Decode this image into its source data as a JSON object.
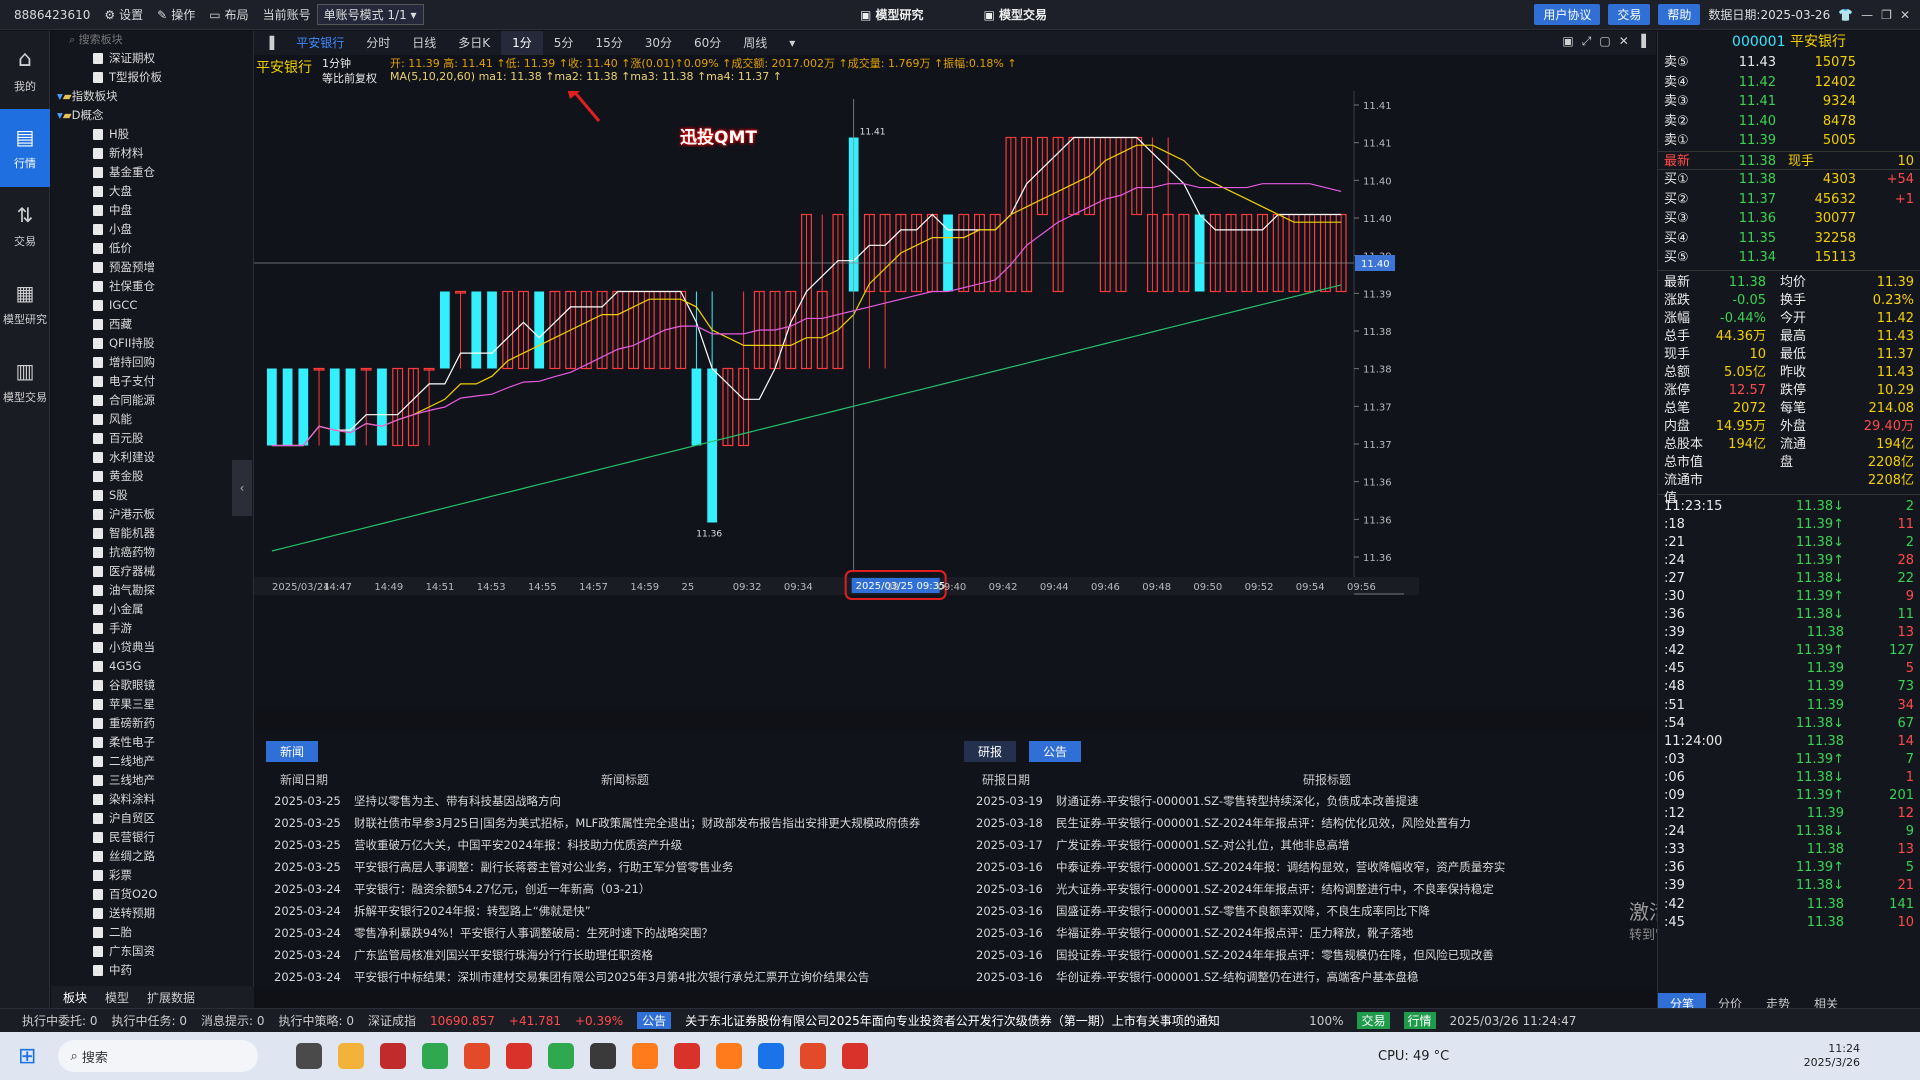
{
  "topbar": {
    "account_id": "8886423610",
    "menu": [
      "设置",
      "操作",
      "布局"
    ],
    "account_label": "当前账号",
    "mode_select": "单账号模式 1/1",
    "center_tabs": [
      "模型研究",
      "模型交易"
    ],
    "right_buttons": [
      "用户协议",
      "交易",
      "帮助"
    ],
    "data_date": "数据日期:2025-03-26"
  },
  "rail": [
    "我的",
    "行情",
    "交易",
    "模型研究",
    "模型交易"
  ],
  "tree": {
    "search_placeholder": "搜索板块",
    "nodes": [
      {
        "label": "深证期权",
        "level": 2,
        "type": "file"
      },
      {
        "label": "T型报价板",
        "level": 2,
        "type": "file"
      },
      {
        "label": "指数板块",
        "level": 1,
        "type": "folder"
      },
      {
        "label": "D概念",
        "level": 1,
        "type": "folder"
      },
      {
        "label": "H股",
        "level": 2,
        "type": "file"
      },
      {
        "label": "新材料",
        "level": 2,
        "type": "file"
      },
      {
        "label": "基金重仓",
        "level": 2,
        "type": "file"
      },
      {
        "label": "大盘",
        "level": 2,
        "type": "file"
      },
      {
        "label": "中盘",
        "level": 2,
        "type": "file"
      },
      {
        "label": "小盘",
        "level": 2,
        "type": "file"
      },
      {
        "label": "低价",
        "level": 2,
        "type": "file"
      },
      {
        "label": "预盈预增",
        "level": 2,
        "type": "file"
      },
      {
        "label": "社保重仓",
        "level": 2,
        "type": "file"
      },
      {
        "label": "IGCC",
        "level": 2,
        "type": "file"
      },
      {
        "label": "西藏",
        "level": 2,
        "type": "file"
      },
      {
        "label": "QFII持股",
        "level": 2,
        "type": "file"
      },
      {
        "label": "增持回购",
        "level": 2,
        "type": "file"
      },
      {
        "label": "电子支付",
        "level": 2,
        "type": "file"
      },
      {
        "label": "合同能源",
        "level": 2,
        "type": "file"
      },
      {
        "label": "风能",
        "level": 2,
        "type": "file"
      },
      {
        "label": "百元股",
        "level": 2,
        "type": "file"
      },
      {
        "label": "水利建设",
        "level": 2,
        "type": "file"
      },
      {
        "label": "黄金股",
        "level": 2,
        "type": "file"
      },
      {
        "label": "S股",
        "level": 2,
        "type": "file"
      },
      {
        "label": "沪港示板",
        "level": 2,
        "type": "file"
      },
      {
        "label": "智能机器",
        "level": 2,
        "type": "file"
      },
      {
        "label": "抗癌药物",
        "level": 2,
        "type": "file"
      },
      {
        "label": "医疗器械",
        "level": 2,
        "type": "file"
      },
      {
        "label": "油气勘探",
        "level": 2,
        "type": "file"
      },
      {
        "label": "小金属",
        "level": 2,
        "type": "file"
      },
      {
        "label": "手游",
        "level": 2,
        "type": "file"
      },
      {
        "label": "小贷典当",
        "level": 2,
        "type": "file"
      },
      {
        "label": "4G5G",
        "level": 2,
        "type": "file"
      },
      {
        "label": "谷歌眼镜",
        "level": 2,
        "type": "file"
      },
      {
        "label": "苹果三星",
        "level": 2,
        "type": "file"
      },
      {
        "label": "重磅新药",
        "level": 2,
        "type": "file"
      },
      {
        "label": "柔性电子",
        "level": 2,
        "type": "file"
      },
      {
        "label": "二线地产",
        "level": 2,
        "type": "file"
      },
      {
        "label": "三线地产",
        "level": 2,
        "type": "file"
      },
      {
        "label": "染料涂料",
        "level": 2,
        "type": "file"
      },
      {
        "label": "沪自贸区",
        "level": 2,
        "type": "file"
      },
      {
        "label": "民营银行",
        "level": 2,
        "type": "file"
      },
      {
        "label": "丝绸之路",
        "level": 2,
        "type": "file"
      },
      {
        "label": "彩票",
        "level": 2,
        "type": "file"
      },
      {
        "label": "百货O2O",
        "level": 2,
        "type": "file"
      },
      {
        "label": "送转预期",
        "level": 2,
        "type": "file"
      },
      {
        "label": "二胎",
        "level": 2,
        "type": "file"
      },
      {
        "label": "广东国资",
        "level": 2,
        "type": "file"
      },
      {
        "label": "中药",
        "level": 2,
        "type": "file"
      }
    ],
    "tabs": [
      "板块",
      "模型",
      "扩展数据"
    ]
  },
  "period_tabs": [
    "平安银行",
    "分时",
    "日线",
    "多日K",
    "1分",
    "5分",
    "15分",
    "30分",
    "60分",
    "周线"
  ],
  "active_period": "1分",
  "info": {
    "stock_name": "平安银行",
    "period": "1分钟",
    "adj": "等比前复权",
    "ohlc": "开: 11.39  高: 11.41 ↑低: 11.39 ↑收: 11.40 ↑涨(0.01)↑0.09% ↑成交额: 2017.002万 ↑成交量: 1.769万 ↑振幅:0.18% ↑",
    "ma_line": "MA(5,10,20,60)  ma1: 11.38 ↑ma2: 11.38 ↑ma3: 11.38 ↑ma4: 11.37 ↑",
    "annotation": "迅投QMT"
  },
  "chart_data": {
    "type": "candlestick",
    "y_ticks": [
      "11.41",
      "11.41",
      "11.40",
      "11.40",
      "11.39",
      "11.39",
      "11.38",
      "11.38",
      "11.37",
      "11.37",
      "11.36",
      "11.36",
      "11.36"
    ],
    "ylim": [
      11.355,
      11.415
    ],
    "x_ticks": [
      "2025/03/24",
      "14:47",
      "14:49",
      "14:51",
      "14:53",
      "14:55",
      "14:57",
      "14:59",
      "25",
      "09:32",
      "09:34",
      "2025/03/25 09:35",
      "38",
      "09:40",
      "09:42",
      "09:44",
      "09:46",
      "09:48",
      "09:50",
      "09:52",
      "09:54",
      "09:56"
    ],
    "crosshair_price": "11.40",
    "crosshair_label": "2025/03/25 09:35",
    "high_label": "11.41",
    "low_label": "11.36",
    "candles": [
      {
        "o": 11.38,
        "h": 11.38,
        "l": 11.37,
        "c": 11.37
      },
      {
        "o": 11.38,
        "h": 11.38,
        "l": 11.37,
        "c": 11.37
      },
      {
        "o": 11.38,
        "h": 11.38,
        "l": 11.37,
        "c": 11.37
      },
      {
        "o": 11.38,
        "h": 11.38,
        "l": 11.37,
        "c": 11.38
      },
      {
        "o": 11.38,
        "h": 11.38,
        "l": 11.37,
        "c": 11.37
      },
      {
        "o": 11.38,
        "h": 11.38,
        "l": 11.37,
        "c": 11.37
      },
      {
        "o": 11.38,
        "h": 11.38,
        "l": 11.37,
        "c": 11.38
      },
      {
        "o": 11.38,
        "h": 11.38,
        "l": 11.37,
        "c": 11.37
      },
      {
        "o": 11.37,
        "h": 11.38,
        "l": 11.37,
        "c": 11.38
      },
      {
        "o": 11.37,
        "h": 11.38,
        "l": 11.37,
        "c": 11.38
      },
      {
        "o": 11.38,
        "h": 11.38,
        "l": 11.37,
        "c": 11.38
      },
      {
        "o": 11.39,
        "h": 11.39,
        "l": 11.38,
        "c": 11.38
      },
      {
        "o": 11.39,
        "h": 11.39,
        "l": 11.38,
        "c": 11.39
      },
      {
        "o": 11.39,
        "h": 11.39,
        "l": 11.38,
        "c": 11.38
      },
      {
        "o": 11.39,
        "h": 11.39,
        "l": 11.38,
        "c": 11.38
      },
      {
        "o": 11.38,
        "h": 11.39,
        "l": 11.38,
        "c": 11.39
      },
      {
        "o": 11.38,
        "h": 11.39,
        "l": 11.38,
        "c": 11.39
      },
      {
        "o": 11.39,
        "h": 11.39,
        "l": 11.38,
        "c": 11.38
      },
      {
        "o": 11.38,
        "h": 11.39,
        "l": 11.38,
        "c": 11.39
      },
      {
        "o": 11.38,
        "h": 11.39,
        "l": 11.38,
        "c": 11.39
      },
      {
        "o": 11.38,
        "h": 11.39,
        "l": 11.38,
        "c": 11.39
      },
      {
        "o": 11.38,
        "h": 11.39,
        "l": 11.38,
        "c": 11.39
      },
      {
        "o": 11.38,
        "h": 11.39,
        "l": 11.38,
        "c": 11.39
      },
      {
        "o": 11.38,
        "h": 11.39,
        "l": 11.38,
        "c": 11.39
      },
      {
        "o": 11.38,
        "h": 11.39,
        "l": 11.38,
        "c": 11.39
      },
      {
        "o": 11.38,
        "h": 11.39,
        "l": 11.38,
        "c": 11.39
      },
      {
        "o": 11.38,
        "h": 11.39,
        "l": 11.38,
        "c": 11.39
      },
      {
        "o": 11.38,
        "h": 11.39,
        "l": 11.37,
        "c": 11.37
      },
      {
        "o": 11.38,
        "h": 11.39,
        "l": 11.36,
        "c": 11.36
      },
      {
        "o": 11.37,
        "h": 11.38,
        "l": 11.37,
        "c": 11.38
      },
      {
        "o": 11.37,
        "h": 11.39,
        "l": 11.37,
        "c": 11.38
      },
      {
        "o": 11.38,
        "h": 11.39,
        "l": 11.38,
        "c": 11.39
      },
      {
        "o": 11.38,
        "h": 11.39,
        "l": 11.38,
        "c": 11.39
      },
      {
        "o": 11.38,
        "h": 11.39,
        "l": 11.38,
        "c": 11.39
      },
      {
        "o": 11.38,
        "h": 11.4,
        "l": 11.38,
        "c": 11.4
      },
      {
        "o": 11.38,
        "h": 11.4,
        "l": 11.38,
        "c": 11.39
      },
      {
        "o": 11.38,
        "h": 11.4,
        "l": 11.38,
        "c": 11.4
      },
      {
        "o": 11.41,
        "h": 11.41,
        "l": 11.39,
        "c": 11.39
      },
      {
        "o": 11.39,
        "h": 11.4,
        "l": 11.38,
        "c": 11.4
      },
      {
        "o": 11.39,
        "h": 11.4,
        "l": 11.38,
        "c": 11.4
      },
      {
        "o": 11.39,
        "h": 11.4,
        "l": 11.39,
        "c": 11.4
      },
      {
        "o": 11.39,
        "h": 11.4,
        "l": 11.39,
        "c": 11.4
      },
      {
        "o": 11.39,
        "h": 11.4,
        "l": 11.39,
        "c": 11.4
      },
      {
        "o": 11.4,
        "h": 11.4,
        "l": 11.39,
        "c": 11.39
      },
      {
        "o": 11.39,
        "h": 11.4,
        "l": 11.39,
        "c": 11.4
      },
      {
        "o": 11.39,
        "h": 11.4,
        "l": 11.39,
        "c": 11.4
      },
      {
        "o": 11.39,
        "h": 11.4,
        "l": 11.39,
        "c": 11.4
      },
      {
        "o": 11.39,
        "h": 11.41,
        "l": 11.39,
        "c": 11.41
      },
      {
        "o": 11.39,
        "h": 11.41,
        "l": 11.39,
        "c": 11.41
      },
      {
        "o": 11.4,
        "h": 11.41,
        "l": 11.4,
        "c": 11.41
      },
      {
        "o": 11.39,
        "h": 11.41,
        "l": 11.39,
        "c": 11.41
      },
      {
        "o": 11.4,
        "h": 11.41,
        "l": 11.4,
        "c": 11.41
      },
      {
        "o": 11.4,
        "h": 11.41,
        "l": 11.4,
        "c": 11.41
      },
      {
        "o": 11.39,
        "h": 11.41,
        "l": 11.39,
        "c": 11.41
      },
      {
        "o": 11.39,
        "h": 11.41,
        "l": 11.39,
        "c": 11.41
      },
      {
        "o": 11.4,
        "h": 11.41,
        "l": 11.4,
        "c": 11.41
      },
      {
        "o": 11.39,
        "h": 11.41,
        "l": 11.39,
        "c": 11.4
      },
      {
        "o": 11.39,
        "h": 11.41,
        "l": 11.39,
        "c": 11.4
      },
      {
        "o": 11.39,
        "h": 11.4,
        "l": 11.39,
        "c": 11.4
      },
      {
        "o": 11.4,
        "h": 11.4,
        "l": 11.39,
        "c": 11.39
      },
      {
        "o": 11.39,
        "h": 11.4,
        "l": 11.39,
        "c": 11.4
      },
      {
        "o": 11.39,
        "h": 11.4,
        "l": 11.39,
        "c": 11.4
      },
      {
        "o": 11.39,
        "h": 11.4,
        "l": 11.39,
        "c": 11.4
      },
      {
        "o": 11.39,
        "h": 11.4,
        "l": 11.39,
        "c": 11.4
      },
      {
        "o": 11.39,
        "h": 11.4,
        "l": 11.39,
        "c": 11.4
      },
      {
        "o": 11.39,
        "h": 11.4,
        "l": 11.39,
        "c": 11.4
      },
      {
        "o": 11.39,
        "h": 11.4,
        "l": 11.39,
        "c": 11.4
      },
      {
        "o": 11.39,
        "h": 11.4,
        "l": 11.39,
        "c": 11.4
      },
      {
        "o": 11.39,
        "h": 11.4,
        "l": 11.39,
        "c": 11.4
      }
    ]
  },
  "right": {
    "code": "000001",
    "name": "平安银行",
    "asks": [
      {
        "label": "卖⑤",
        "price": "11.43",
        "vol": "15075"
      },
      {
        "label": "卖④",
        "price": "11.42",
        "vol": "12402"
      },
      {
        "label": "卖③",
        "price": "11.41",
        "vol": "9324"
      },
      {
        "label": "卖②",
        "price": "11.40",
        "vol": "8478"
      },
      {
        "label": "卖①",
        "price": "11.39",
        "vol": "5005"
      }
    ],
    "last": {
      "label": "最新",
      "price": "11.38",
      "hand": "现手",
      "vol": "10"
    },
    "bids": [
      {
        "label": "买①",
        "price": "11.38",
        "vol": "4303",
        "chg": "+54"
      },
      {
        "label": "买②",
        "price": "11.37",
        "vol": "45632",
        "chg": "+1"
      },
      {
        "label": "买③",
        "price": "11.36",
        "vol": "30077",
        "chg": ""
      },
      {
        "label": "买④",
        "price": "11.35",
        "vol": "32258",
        "chg": ""
      },
      {
        "label": "买⑤",
        "price": "11.34",
        "vol": "15113",
        "chg": ""
      }
    ],
    "stats": [
      [
        "最新",
        "11.38",
        "均价",
        "11.39"
      ],
      [
        "涨跌",
        "-0.05",
        "换手",
        "0.23%"
      ],
      [
        "涨幅",
        "-0.44%",
        "今开",
        "11.42"
      ],
      [
        "总手",
        "44.36万",
        "最高",
        "11.43"
      ],
      [
        "现手",
        "10",
        "最低",
        "11.37"
      ],
      [
        "总额",
        "5.05亿",
        "昨收",
        "11.43"
      ],
      [
        "涨停",
        "12.57",
        "跌停",
        "10.29"
      ],
      [
        "总笔",
        "2072",
        "每笔",
        "214.08"
      ],
      [
        "内盘",
        "14.95万",
        "外盘",
        "29.40万"
      ],
      [
        "总股本",
        "194亿",
        "流通盘",
        "194亿"
      ],
      [
        "总市值",
        "",
        "",
        "2208亿"
      ],
      [
        "流通市值",
        "",
        "",
        "2208亿"
      ]
    ],
    "ticks": [
      [
        "11:23:15",
        "11.38↓",
        "2"
      ],
      [
        ":18",
        "11.39↑",
        "11"
      ],
      [
        ":21",
        "11.38↓",
        "2"
      ],
      [
        ":24",
        "11.39↑",
        "28"
      ],
      [
        ":27",
        "11.38↓",
        "22"
      ],
      [
        ":30",
        "11.39↑",
        "9"
      ],
      [
        ":36",
        "11.38↓",
        "11"
      ],
      [
        ":39",
        "11.38",
        "13"
      ],
      [
        ":42",
        "11.39↑",
        "127"
      ],
      [
        ":45",
        "11.39",
        "5"
      ],
      [
        ":48",
        "11.39",
        "73"
      ],
      [
        ":51",
        "11.39",
        "34"
      ],
      [
        ":54",
        "11.38↓",
        "67"
      ],
      [
        "11:24:00",
        "11.38",
        "14"
      ],
      [
        ":03",
        "11.39↑",
        "7"
      ],
      [
        ":06",
        "11.38↓",
        "1"
      ],
      [
        ":09",
        "11.39↑",
        "201"
      ],
      [
        ":12",
        "11.39",
        "12"
      ],
      [
        ":24",
        "11.38↓",
        "9"
      ],
      [
        ":33",
        "11.38",
        "13"
      ],
      [
        ":36",
        "11.39↑",
        "5"
      ],
      [
        ":39",
        "11.38↓",
        "21"
      ],
      [
        ":42",
        "11.38",
        "141"
      ],
      [
        ":45",
        "11.38",
        "10"
      ]
    ],
    "bottom_tabs": [
      "分笔",
      "分价",
      "走势",
      "相关"
    ]
  },
  "news": {
    "left_tab": "新闻",
    "left_headers": [
      "新闻日期",
      "新闻标题"
    ],
    "left_rows": [
      [
        "2025-03-25",
        "坚持以零售为主、带有科技基因战略方向"
      ],
      [
        "2025-03-25",
        "财联社债市早参3月25日|国务为美式招标，MLF政策属性完全退出；财政部发布报告指出安排更大规模政府债券"
      ],
      [
        "2025-03-25",
        "营收重破万亿大关，中国平安2024年报：科技助力优质资产升级"
      ],
      [
        "2025-03-25",
        "平安银行高层人事调整：副行长蒋蓉主管对公业务，行助王军分管零售业务"
      ],
      [
        "2025-03-24",
        "平安银行：融资余额54.27亿元，创近一年新高（03-21）"
      ],
      [
        "2025-03-24",
        "拆解平安银行2024年报：转型路上“佛就是快”"
      ],
      [
        "2025-03-24",
        "零售净利暴跌94%！平安银行人事调整破局：生死时速下的战略突围？"
      ],
      [
        "2025-03-24",
        "广东监管局核准刘国兴平安银行珠海分行行长助理任职资格"
      ],
      [
        "2025-03-24",
        "平安银行中标结果：深圳市建材交易集团有限公司2025年3月第4批次银行承兑汇票开立询价结果公告"
      ]
    ],
    "right_tabs": [
      "研报",
      "公告"
    ],
    "right_headers": [
      "研报日期",
      "研报标题"
    ],
    "right_rows": [
      [
        "2025-03-19",
        "财通证券-平安银行-000001.SZ-零售转型持续深化，负债成本改善提速"
      ],
      [
        "2025-03-18",
        "民生证券-平安银行-000001.SZ-2024年年报点评：结构优化见效，风险处置有力"
      ],
      [
        "2025-03-17",
        "广发证券-平安银行-000001.SZ-对公扎位，其他非息高增"
      ],
      [
        "2025-03-16",
        "中泰证券-平安银行-000001.SZ-2024年报：调结构显效，营收降幅收窄，资产质量夯实"
      ],
      [
        "2025-03-16",
        "光大证券-平安银行-000001.SZ-2024年年报点评：结构调整进行中，不良率保持稳定"
      ],
      [
        "2025-03-16",
        "国盛证券-平安银行-000001.SZ-零售不良额率双降，不良生成率同比下降"
      ],
      [
        "2025-03-16",
        "华福证券-平安银行-000001.SZ-2024年报点评：压力释放，靴子落地"
      ],
      [
        "2025-03-16",
        "国投证券-平安银行-000001.SZ-2024年年报点评：零售规模仍在降，但风险已现改善"
      ],
      [
        "2025-03-16",
        "华创证券-平安银行-000001.SZ-结构调整仍在进行，高端客户基本盘稳"
      ]
    ],
    "watermark1": "激活 Windows",
    "watermark2": "转到\"设置\"以激活 Windows。"
  },
  "status": {
    "items": [
      "执行中委托: 0",
      "执行中任务: 0",
      "消息提示: 0",
      "执行中策略: 0"
    ],
    "index_name": "深证成指",
    "index_value": "10690.857",
    "index_chg": "+41.781",
    "index_pct": "+0.39%",
    "notice_badge": "公告",
    "notice": "关于东北证券股份有限公司2025年面向专业投资者公开发行次级债券（第一期）上市有关事项的通知",
    "zoom": "100%",
    "trade_btn": "交易",
    "market_btn": "行情",
    "datetime": "2025/03/26 11:24:47"
  },
  "taskbar": {
    "search": "搜索",
    "cpu": "CPU: 49 °C",
    "time": "11:24",
    "date": "2025/3/26"
  }
}
